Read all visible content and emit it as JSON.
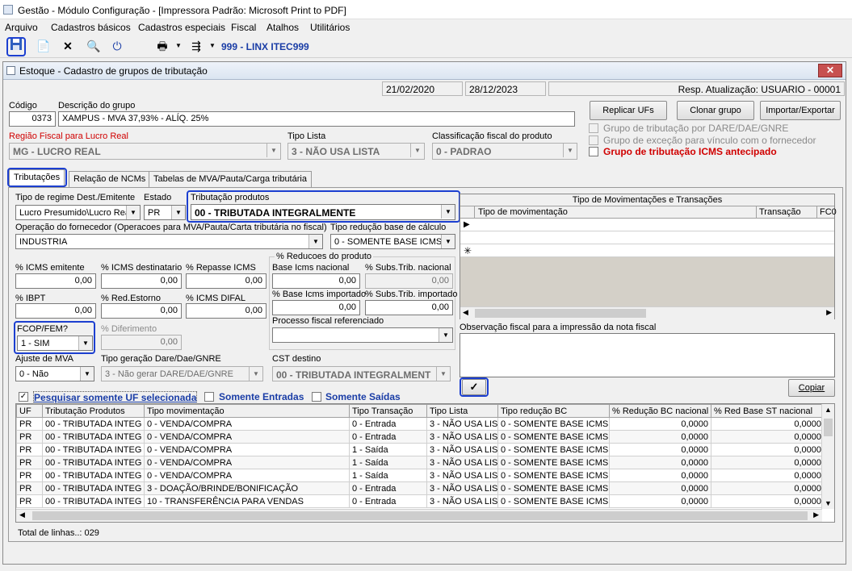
{
  "window": {
    "title": "Gestão  - Módulo Configuração - [Impressora Padrão: Microsoft Print to PDF]"
  },
  "menu": [
    "Arquivo",
    "Cadastros básicos",
    "Cadastros especiais",
    "Fiscal",
    "Atalhos",
    "Utilitários"
  ],
  "toolbar": {
    "company": "999 - LINX ITEC999"
  },
  "form": {
    "title": "Estoque - Cadastro de grupos de tributação",
    "close_label": "✕",
    "dates": [
      "21/02/2020",
      "28/12/2023"
    ],
    "resp": "Resp. Atualização: USUARIO - 00001",
    "codigo_label": "Código",
    "codigo": "0373",
    "descricao_label": "Descrição do grupo",
    "descricao": "XAMPUS - MVA 37,93% - ALÍQ. 25%",
    "regiao_label": "Região Fiscal para Lucro Real",
    "regiao": "MG - LUCRO REAL",
    "tipo_lista_label": "Tipo Lista",
    "tipo_lista": "3 - NÃO USA LISTA",
    "classificacao_label": "Classificação fiscal do produto",
    "classificacao": "0 - PADRAO",
    "buttons": {
      "replicar": "Replicar UFs",
      "clonar": "Clonar grupo",
      "importar": "Importar/Exportar",
      "copiar": "Copiar",
      "check": "✓"
    },
    "checks": {
      "dare": "Grupo de tributação por DARE/DAE/GNRE",
      "excecao": "Grupo de exceção para vínculo com o fornecedor",
      "icms_antecipado": "Grupo de tributação ICMS antecipado"
    },
    "tabs": [
      "Tributações",
      "Relação de NCMs",
      "Tabelas de MVA/Pauta/Carga tributária"
    ]
  },
  "trib": {
    "regime_label": "Tipo de regime Dest./Emitente",
    "regime": "Lucro Presumido\\Lucro Rea",
    "estado_label": "Estado",
    "estado": "PR",
    "tribut_label": "Tributação produtos",
    "tribut": "00 - TRIBUTADA INTEGRALMENTE",
    "operacao_label": "Operação do fornecedor (Operacoes para MVA/Pauta/Carta tributária no fiscal)",
    "operacao": "INDUSTRIA",
    "tipo_reducao_label": "Tipo redução base de cálculo",
    "tipo_reducao": "0 - SOMENTE BASE ICMS",
    "icms_emitente_label": "% ICMS emitente",
    "icms_emitente": "0,00",
    "icms_dest_label": "% ICMS destinatario",
    "icms_dest": "0,00",
    "repasse_label": "% Repasse ICMS",
    "repasse": "0,00",
    "ibpt_label": "% IBPT",
    "ibpt": "0,00",
    "red_estorno_label": "% Red.Estorno",
    "red_estorno": "0,00",
    "icms_difal_label": "% ICMS DIFAL",
    "icms_difal": "0,00",
    "fcop_label": "FCOP/FEM?",
    "fcop": "1 - SIM",
    "diferimento_label": "% Diferimento",
    "diferimento": "0,00",
    "reducoes_title": "% Reducoes do produto",
    "base_nac_label": "Base Icms nacional",
    "base_nac": "0,00",
    "subs_nac_label": "% Subs.Trib. nacional",
    "subs_nac": "0,00",
    "base_imp_label": "% Base Icms importado",
    "base_imp": "0,00",
    "subs_imp_label": "% Subs.Trib. importado",
    "subs_imp": "0,00",
    "processo_label": "Processo fiscal referenciado",
    "processo": "",
    "ajuste_label": "Ajuste de MVA",
    "ajuste": "0 - Não",
    "tipo_geracao_label": "Tipo geração Dare/Dae/GNRE",
    "tipo_geracao": "3 - Não gerar DARE/DAE/GNRE",
    "cst_label": "CST destino",
    "cst": "00 - TRIBUTADA INTEGRALMENT"
  },
  "mov": {
    "title": "Tipo de Movimentações e Transações",
    "headers": [
      "Tipo de movimentação",
      "Transação",
      "FC0"
    ],
    "obs_label": "Observação fiscal para a impressão da nota fiscal"
  },
  "filters": {
    "uf": "Pesquisar somente UF selecionada",
    "entradas": "Somente Entradas",
    "saidas": "Somente Saídas"
  },
  "table": {
    "headers": [
      "UF",
      "Tributação Produtos",
      "Tipo movimentação",
      "Tipo Transação",
      "Tipo Lista",
      "Tipo redução BC",
      "% Redução BC nacional",
      "% Red Base ST nacional"
    ],
    "rows": [
      [
        "PR",
        "00 - TRIBUTADA INTEG",
        "0   - VENDA/COMPRA",
        "0 - Entrada",
        "3 - NÃO USA LIS",
        "0 - SOMENTE BASE ICMS",
        "0,0000",
        "0,0000"
      ],
      [
        "PR",
        "00 - TRIBUTADA INTEG",
        "0   - VENDA/COMPRA",
        "0 - Entrada",
        "3 - NÃO USA LIS",
        "0 - SOMENTE BASE ICMS",
        "0,0000",
        "0,0000"
      ],
      [
        "PR",
        "00 - TRIBUTADA INTEG",
        "0   - VENDA/COMPRA",
        "1 - Saída",
        "3 - NÃO USA LIS",
        "0 - SOMENTE BASE ICMS",
        "0,0000",
        "0,0000"
      ],
      [
        "PR",
        "00 - TRIBUTADA INTEG",
        "0   - VENDA/COMPRA",
        "1 - Saída",
        "3 - NÃO USA LIS",
        "0 - SOMENTE BASE ICMS",
        "0,0000",
        "0,0000"
      ],
      [
        "PR",
        "00 - TRIBUTADA INTEG",
        "0   - VENDA/COMPRA",
        "1 - Saída",
        "3 - NÃO USA LIS",
        "0 - SOMENTE BASE ICMS",
        "0,0000",
        "0,0000"
      ],
      [
        "PR",
        "00 - TRIBUTADA INTEG",
        "3   - DOAÇÃO/BRINDE/BONIFICAÇÃO",
        "0 - Entrada",
        "3 - NÃO USA LIS",
        "0 - SOMENTE BASE ICMS",
        "0,0000",
        "0,0000"
      ],
      [
        "PR",
        "00 - TRIBUTADA INTEG",
        "10 - TRANSFERÊNCIA PARA VENDAS",
        "0 - Entrada",
        "3 - NÃO USA LIS",
        "0 - SOMENTE BASE ICMS",
        "0,0000",
        "0,0000"
      ]
    ],
    "total": "Total de linhas..: 029"
  }
}
